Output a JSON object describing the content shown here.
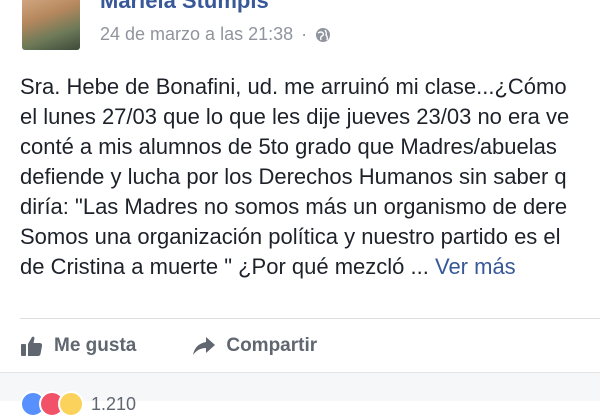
{
  "post": {
    "author": "Mariela Stumpis",
    "timestamp": "24 de marzo a las 21:38",
    "separator": "·",
    "privacy_icon": "globe-icon",
    "lines": [
      "Sra. Hebe de Bonafini, ud. me arruinó mi clase...¿Cómo",
      "el lunes 27/03 que lo que les dije jueves 23/03 no era ve",
      "conté a mis alumnos de 5to grado que Madres/abuelas",
      "defiende y lucha por los Derechos Humanos sin saber q",
      "diría: \"Las Madres no somos más un organismo de dere",
      "Somos una organización política y nuestro partido es el",
      "de Cristina a muerte \" ¿Por qué mezcló ..."
    ],
    "see_more": "Ver más"
  },
  "actions": {
    "like_label": "Me gusta",
    "share_label": "Compartir"
  },
  "reactions": {
    "count": "1.210"
  },
  "colors": {
    "link": "#385898",
    "text": "#1d2129",
    "muted": "#90949c",
    "action": "#606770"
  }
}
